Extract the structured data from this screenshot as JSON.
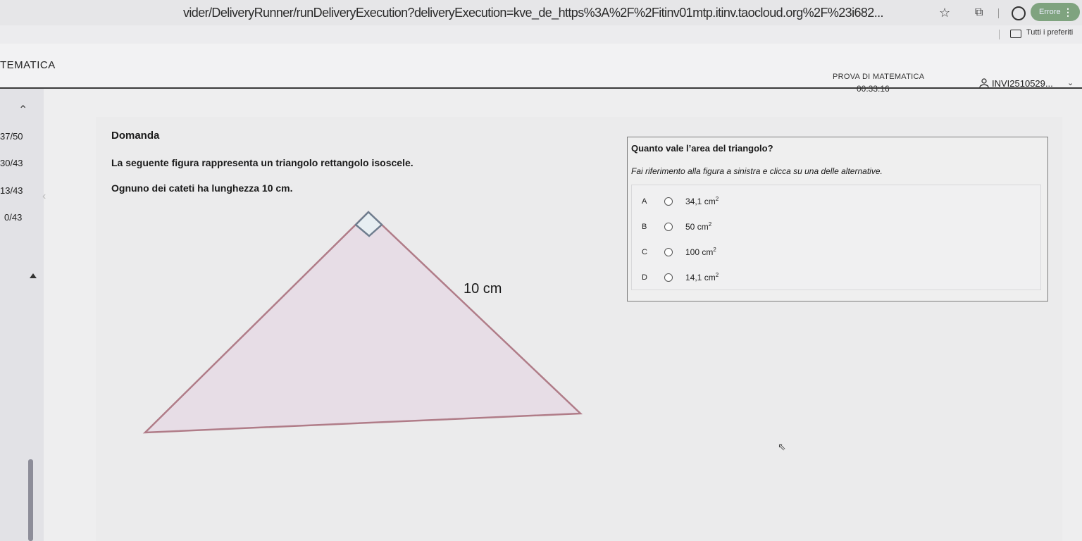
{
  "browser": {
    "url": "vider/DeliveryRunner/runDeliveryExecution?deliveryExecution=kve_de_https%3A%2F%2Fitinv01mtp.itinv.taocloud.org%2F%23i682...",
    "error_label": "Errore",
    "bookmarks_label": "Tutti i preferiti"
  },
  "header": {
    "subject": "TEMATICA",
    "test_name": "PROVA DI MATEMATICA",
    "timer": "00:33:16",
    "user": "INVI2510529..."
  },
  "sidebar": {
    "items": [
      "37/50",
      "30/43",
      "13/43",
      "0/43"
    ]
  },
  "question": {
    "title": "Domanda",
    "line1": "La seguente figura rappresenta un triangolo rettangolo isoscele.",
    "line2": "Ognuno dei cateti ha lunghezza 10 cm.",
    "figure_label": "10 cm"
  },
  "answer": {
    "question": "Quanto vale l’area del triangolo?",
    "hint": "Fai riferimento alla figura a sinistra e clicca su una delle alternative.",
    "choices": [
      {
        "letter": "A",
        "value": "34,1",
        "unit": "cm",
        "exp": "2"
      },
      {
        "letter": "B",
        "value": "50",
        "unit": "cm",
        "exp": "2"
      },
      {
        "letter": "C",
        "value": "100",
        "unit": "cm",
        "exp": "2"
      },
      {
        "letter": "D",
        "value": "14,1",
        "unit": "cm",
        "exp": "2"
      }
    ]
  },
  "colors": {
    "triangle_fill": "#e7dde6",
    "triangle_stroke": "#b07c88",
    "accent_button": "#7fa37f"
  }
}
